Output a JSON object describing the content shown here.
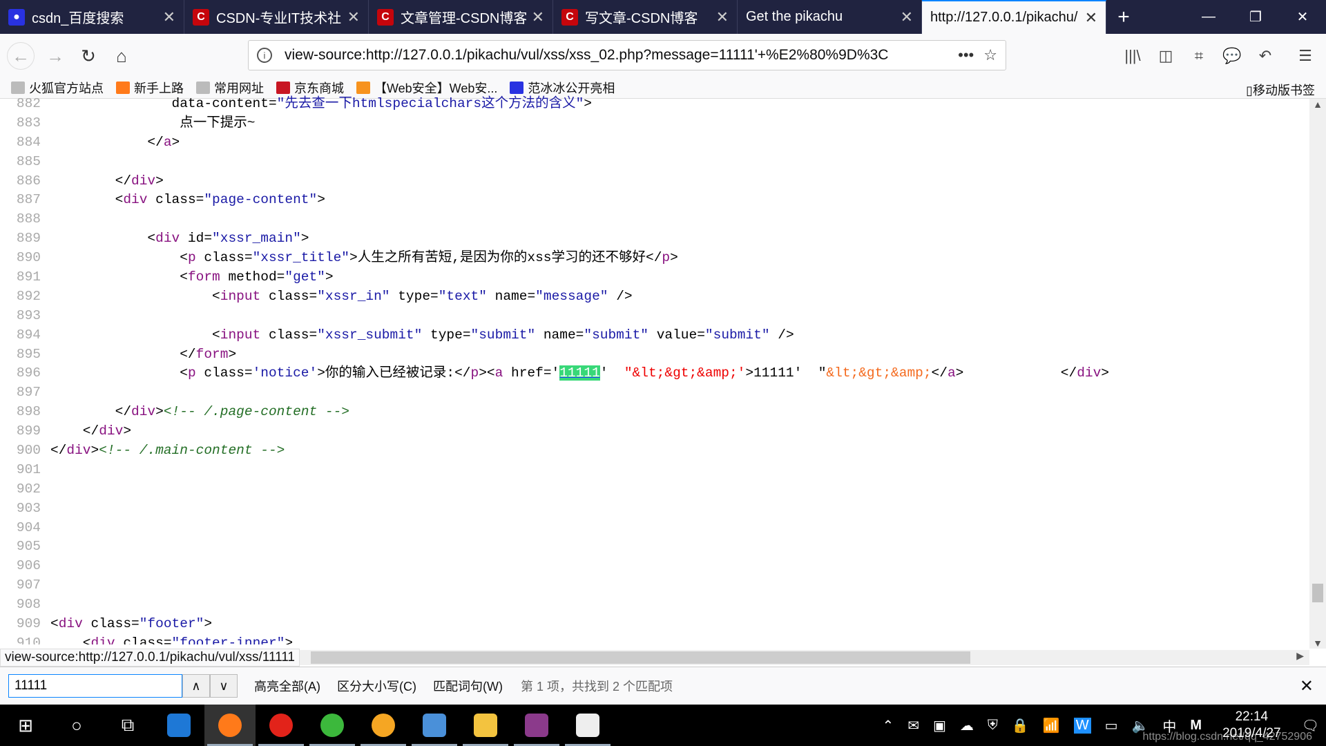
{
  "tabs": [
    {
      "title": "csdn_百度搜索",
      "icon": "baidu-paw-icon",
      "color": "#2932e1",
      "active": false
    },
    {
      "title": "CSDN-专业IT技术社区",
      "icon": "csdn-logo-icon",
      "color": "#c5050c",
      "active": false
    },
    {
      "title": "文章管理-CSDN博客",
      "icon": "csdn-logo-icon",
      "color": "#c5050c",
      "active": false
    },
    {
      "title": "写文章-CSDN博客",
      "icon": "csdn-logo-icon",
      "color": "#c5050c",
      "active": false
    },
    {
      "title": "Get the pikachu",
      "icon": "",
      "color": "",
      "active": false
    },
    {
      "title": "http://127.0.0.1/pikachu/",
      "icon": "",
      "color": "",
      "active": true
    }
  ],
  "url": "view-source:http://127.0.0.1/pikachu/vul/xss/xss_02.php?message=11111'+%E2%80%9D%3C",
  "bookmarks": [
    {
      "label": "火狐官方站点",
      "icon": "folder-icon",
      "color": "#bbb"
    },
    {
      "label": "新手上路",
      "icon": "firefox-icon",
      "color": "#ff7a1a"
    },
    {
      "label": "常用网址",
      "icon": "folder-icon",
      "color": "#bbb"
    },
    {
      "label": "京东商城",
      "icon": "jd-icon",
      "color": "#c81623"
    },
    {
      "label": "【Web安全】Web安...",
      "icon": "info-bulb-icon",
      "color": "#f7931e"
    },
    {
      "label": "范冰冰公开亮相",
      "icon": "baidu-paw-icon",
      "color": "#2932e1"
    }
  ],
  "mobile_bookmarks": "移动版书签",
  "code_lines": [
    {
      "n": "882",
      "s": [
        [
          "an",
          "               data-content="
        ],
        [
          "av",
          "\"先去查一下htmlspecialchars这个方法的含义\""
        ],
        [
          "p",
          ">"
        ]
      ]
    },
    {
      "n": "883",
      "s": [
        [
          "p",
          "                点一下提示~"
        ]
      ]
    },
    {
      "n": "884",
      "s": [
        [
          "p",
          "            </"
        ],
        [
          "tg",
          "a"
        ],
        [
          "p",
          ">"
        ]
      ]
    },
    {
      "n": "885",
      "s": []
    },
    {
      "n": "886",
      "s": [
        [
          "p",
          "        </"
        ],
        [
          "tg",
          "div"
        ],
        [
          "p",
          ">"
        ]
      ]
    },
    {
      "n": "887",
      "s": [
        [
          "p",
          "        <"
        ],
        [
          "tg",
          "div"
        ],
        [
          "an",
          " class="
        ],
        [
          "av",
          "\"page-content\""
        ],
        [
          "p",
          ">"
        ]
      ]
    },
    {
      "n": "888",
      "s": []
    },
    {
      "n": "889",
      "s": [
        [
          "p",
          "            <"
        ],
        [
          "tg",
          "div"
        ],
        [
          "an",
          " id="
        ],
        [
          "av",
          "\"xssr_main\""
        ],
        [
          "p",
          ">"
        ]
      ]
    },
    {
      "n": "890",
      "s": [
        [
          "p",
          "                <"
        ],
        [
          "tg",
          "p"
        ],
        [
          "an",
          " class="
        ],
        [
          "av",
          "\"xssr_title\""
        ],
        [
          "p",
          ">人生之所有苦短,是因为你的xss学习的还不够好</"
        ],
        [
          "tg",
          "p"
        ],
        [
          "p",
          ">"
        ]
      ]
    },
    {
      "n": "891",
      "s": [
        [
          "p",
          "                <"
        ],
        [
          "tg",
          "form"
        ],
        [
          "an",
          " method="
        ],
        [
          "av",
          "\"get\""
        ],
        [
          "p",
          ">"
        ]
      ]
    },
    {
      "n": "892",
      "s": [
        [
          "p",
          "                    <"
        ],
        [
          "tg",
          "input"
        ],
        [
          "an",
          " class="
        ],
        [
          "av",
          "\"xssr_in\""
        ],
        [
          "an",
          " type="
        ],
        [
          "av",
          "\"text\""
        ],
        [
          "an",
          " name="
        ],
        [
          "av",
          "\"message\""
        ],
        [
          "p",
          " />"
        ]
      ]
    },
    {
      "n": "893",
      "s": []
    },
    {
      "n": "894",
      "s": [
        [
          "p",
          "                    <"
        ],
        [
          "tg",
          "input"
        ],
        [
          "an",
          " class="
        ],
        [
          "av",
          "\"xssr_submit\""
        ],
        [
          "an",
          " type="
        ],
        [
          "av",
          "\"submit\""
        ],
        [
          "an",
          " name="
        ],
        [
          "av",
          "\"submit\""
        ],
        [
          "an",
          " value="
        ],
        [
          "av",
          "\"submit\""
        ],
        [
          "p",
          " />"
        ]
      ]
    },
    {
      "n": "895",
      "s": [
        [
          "p",
          "                </"
        ],
        [
          "tg",
          "form"
        ],
        [
          "p",
          ">"
        ]
      ]
    },
    {
      "n": "896",
      "s": [
        [
          "p",
          "                <"
        ],
        [
          "tg",
          "p"
        ],
        [
          "an",
          " class="
        ],
        [
          "av",
          "'notice'"
        ],
        [
          "p",
          ">你的输入已经被记录:</"
        ],
        [
          "tg",
          "p"
        ],
        [
          "p",
          "><"
        ],
        [
          "tg",
          "a"
        ],
        [
          "an",
          " href='"
        ],
        [
          "hl",
          "11111"
        ],
        [
          "an",
          "'"
        ],
        [
          "er",
          "  \"&lt;&gt;&amp;'"
        ],
        [
          "p",
          ">11111'  \""
        ],
        [
          "er2",
          "&lt;&gt;&amp;"
        ],
        [
          "p",
          "</"
        ],
        [
          "tg",
          "a"
        ],
        [
          "p",
          ">            </"
        ],
        [
          "tg",
          "div"
        ],
        [
          "p",
          ">"
        ]
      ]
    },
    {
      "n": "897",
      "s": []
    },
    {
      "n": "898",
      "s": [
        [
          "p",
          "        </"
        ],
        [
          "tg",
          "div"
        ],
        [
          "p",
          ">"
        ],
        [
          "cm",
          "<!-- /.page-content -->"
        ]
      ]
    },
    {
      "n": "899",
      "s": [
        [
          "p",
          "    </"
        ],
        [
          "tg",
          "div"
        ],
        [
          "p",
          ">"
        ]
      ]
    },
    {
      "n": "900",
      "s": [
        [
          "p",
          "</"
        ],
        [
          "tg",
          "div"
        ],
        [
          "p",
          ">"
        ],
        [
          "cm",
          "<!-- /.main-content -->"
        ]
      ]
    },
    {
      "n": "901",
      "s": []
    },
    {
      "n": "902",
      "s": []
    },
    {
      "n": "903",
      "s": []
    },
    {
      "n": "904",
      "s": []
    },
    {
      "n": "905",
      "s": []
    },
    {
      "n": "906",
      "s": []
    },
    {
      "n": "907",
      "s": []
    },
    {
      "n": "908",
      "s": []
    },
    {
      "n": "909",
      "s": [
        [
          "p",
          "<"
        ],
        [
          "tg",
          "div"
        ],
        [
          "an",
          " class="
        ],
        [
          "av",
          "\"footer\""
        ],
        [
          "p",
          ">"
        ]
      ]
    },
    {
      "n": "910",
      "s": [
        [
          "p",
          "    <"
        ],
        [
          "tg",
          "div"
        ],
        [
          "an",
          " class="
        ],
        [
          "av",
          "\"footer-inner\""
        ],
        [
          "p",
          ">"
        ]
      ]
    }
  ],
  "status_url": "view-source:http://127.0.0.1/pikachu/vul/xss/11111",
  "find": {
    "value": "11111",
    "highlight_all": "高亮全部(A)",
    "match_case": "区分大小写(C)",
    "whole_words": "匹配词句(W)",
    "result": "第 1 项，共找到 2 个匹配项"
  },
  "taskbar": {
    "time": "22:14",
    "date": "2019/4/27",
    "ime": "中",
    "watermark": "https://blog.csdn.net/qq_42752906"
  }
}
